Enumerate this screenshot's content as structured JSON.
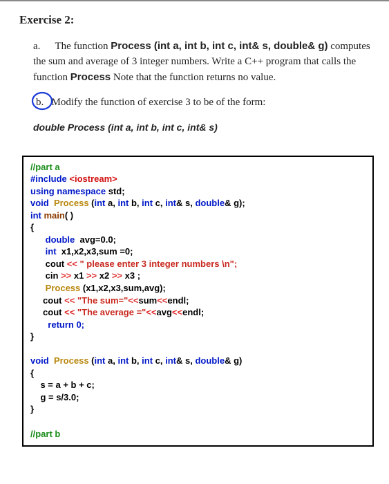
{
  "title": "Exercise 2:",
  "part_a": {
    "label": "a.",
    "lead": "The function ",
    "sig": "Process (int a, int b, int c, int& s, double& g)",
    "body1": " computes the sum and average of 3 integer numbers. Write a C++ program that calls the function ",
    "proc_word": "Process",
    "body2": " Note that the function returns no value."
  },
  "part_b": {
    "label": "b.",
    "text": "Modify the function of exercise 3 to be of the form:"
  },
  "sig_line": "double Process (int a, int b, int c, int& s)",
  "code": {
    "l1": "//part a",
    "l2a": "#include ",
    "l2b": "<iostream>",
    "l3a": "using namespace ",
    "l3b": "std;",
    "l4a": "void  ",
    "l4b": "Process ",
    "l4c": "(int ",
    "l4d": "a, ",
    "l4e": "int ",
    "l4f": "b, ",
    "l4g": "int ",
    "l4h": "c, ",
    "l4i": "int",
    "l4j": "& s, ",
    "l4k": "double",
    "l4l": "& g);",
    "l5a": "int ",
    "l5b": "main",
    "l5c": "( )",
    "l6": "{",
    "l7a": "      double  ",
    "l7b": "avg=0.0;",
    "l8a": "      int  ",
    "l8b": "x1,x2,x3,sum =0;",
    "l9a": "      cout ",
    "l9b": "<< ",
    "l9c": "\" please enter 3 integer numbers \\n\";",
    "l10a": "      cin ",
    "l10b": ">> ",
    "l10c": "x1 ",
    "l10d": ">> ",
    "l10e": "x2 ",
    "l10f": ">> ",
    "l10g": "x3 ;",
    "l11a": "      Process ",
    "l11b": "(x1,x2,x3,sum,avg);",
    "l12a": "     cout ",
    "l12b": "<< ",
    "l12c": "\"The sum=\"",
    "l12d": "<<",
    "l12e": "sum",
    "l12f": "<<",
    "l12g": "endl;",
    "l13a": "     cout ",
    "l13b": "<< ",
    "l13c": "\"The average =\"",
    "l13d": "<<",
    "l13e": "avg",
    "l13f": "<<",
    "l13g": "endl;",
    "l14": "       return 0;",
    "l15": "}",
    "blank": " ",
    "l16a": "void  ",
    "l16b": "Process ",
    "l16c": "(int ",
    "l16d": "a, ",
    "l16e": "int ",
    "l16f": "b, ",
    "l16g": "int ",
    "l16h": "c, ",
    "l16i": "int",
    "l16j": "& s, ",
    "l16k": "double",
    "l16l": "& g)",
    "l17": "{",
    "l18": "    s = a + b + c;",
    "l19": "    g = s/3.0;",
    "l20": "}",
    "l21": "//part b"
  }
}
